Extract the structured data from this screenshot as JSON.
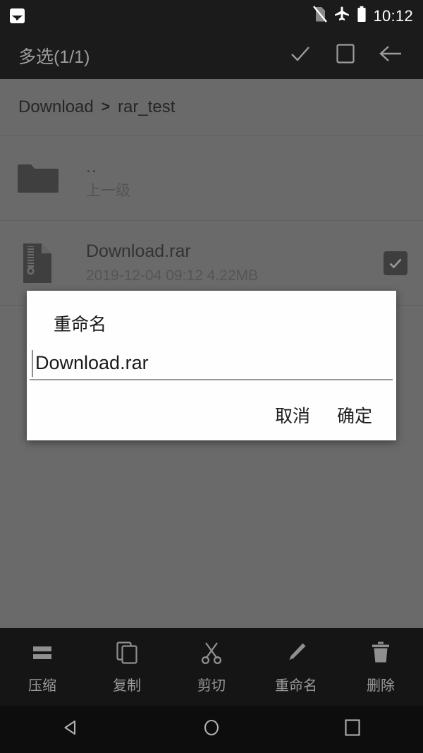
{
  "status_bar": {
    "time": "10:12",
    "icons": [
      "gallery-icon",
      "no-sim-icon",
      "airplane-mode-icon",
      "battery-icon"
    ]
  },
  "app_bar": {
    "title": "多选(1/1)",
    "actions": [
      {
        "name": "confirm-icon",
        "label": "确认"
      },
      {
        "name": "select-all-icon",
        "label": "全选"
      },
      {
        "name": "back-arrow-icon",
        "label": "返回"
      }
    ]
  },
  "breadcrumb": {
    "root": "Download",
    "separator": ">",
    "current": "rar_test"
  },
  "file_list": [
    {
      "icon": "folder-icon",
      "name": "..",
      "meta": "上一级",
      "checkbox": false
    },
    {
      "icon": "archive-file-icon",
      "name": "Download.rar",
      "meta": "2019-12-04 09:12  4.22MB",
      "checkbox": true
    }
  ],
  "dialog": {
    "title": "重命名",
    "input_value": "Download.rar",
    "cancel_label": "取消",
    "confirm_label": "确定"
  },
  "action_bar": [
    {
      "icon": "compress-icon",
      "label": "压缩"
    },
    {
      "icon": "copy-icon",
      "label": "复制"
    },
    {
      "icon": "cut-icon",
      "label": "剪切"
    },
    {
      "icon": "rename-pencil-icon",
      "label": "重命名"
    },
    {
      "icon": "delete-trash-icon",
      "label": "删除"
    }
  ],
  "nav_bar": [
    {
      "icon": "nav-back-icon"
    },
    {
      "icon": "nav-home-icon"
    },
    {
      "icon": "nav-recents-icon"
    }
  ],
  "colors": {
    "toolbar_bg": "#1b1b1b",
    "content_bg": "#6a6a6a",
    "dialog_bg": "#fefefe",
    "action_bar_bg": "#151515",
    "nav_bar_bg": "#0d0d0d"
  }
}
